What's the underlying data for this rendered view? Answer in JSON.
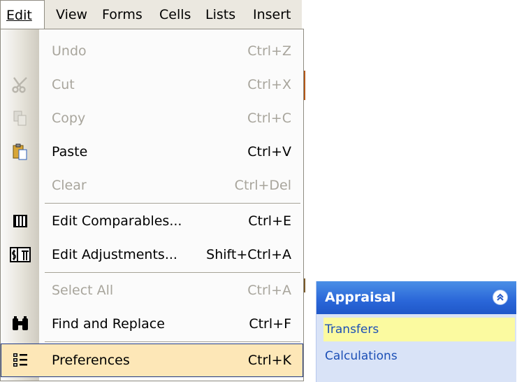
{
  "menubar": {
    "items": [
      {
        "label": "Edit",
        "active": true
      },
      {
        "label": "View"
      },
      {
        "label": "Forms"
      },
      {
        "label": "Cells"
      },
      {
        "label": "Lists"
      },
      {
        "label": "Insert"
      }
    ]
  },
  "edit_menu": {
    "undo": {
      "label": "Undo",
      "shortcut": "Ctrl+Z",
      "enabled": false
    },
    "cut": {
      "label": "Cut",
      "shortcut": "Ctrl+X",
      "enabled": false,
      "icon": "scissors-icon"
    },
    "copy": {
      "label": "Copy",
      "shortcut": "Ctrl+C",
      "enabled": false,
      "icon": "copy-icon"
    },
    "paste": {
      "label": "Paste",
      "shortcut": "Ctrl+V",
      "enabled": true,
      "icon": "clipboard-icon"
    },
    "clear": {
      "label": "Clear",
      "shortcut": "Ctrl+Del",
      "enabled": false
    },
    "edit_comparables": {
      "label": "Edit Comparables...",
      "shortcut": "Ctrl+E",
      "enabled": true,
      "icon": "grid-icon"
    },
    "edit_adjustments": {
      "label": "Edit Adjustments...",
      "shortcut": "Shift+Ctrl+A",
      "enabled": true,
      "icon": "adjustments-icon"
    },
    "select_all": {
      "label": "Select All",
      "shortcut": "Ctrl+A",
      "enabled": false
    },
    "find_replace": {
      "label": "Find and Replace",
      "shortcut": "Ctrl+F",
      "enabled": true,
      "icon": "binoculars-icon"
    },
    "preferences": {
      "label": "Preferences",
      "shortcut": "Ctrl+K",
      "enabled": true,
      "highlighted": true,
      "icon": "list-icon"
    }
  },
  "panel": {
    "title": "Appraisal",
    "collapse_icon": "chevron-double-up-icon",
    "links": [
      {
        "label": "Transfers",
        "selected": true
      },
      {
        "label": "Calculations"
      }
    ]
  },
  "colors": {
    "menu_highlight": "#fde7b7",
    "panel_header": "#2a66d8",
    "panel_body": "#d9e3f7",
    "selected_link": "#fbfaa0",
    "link_text": "#1c4fb6"
  }
}
